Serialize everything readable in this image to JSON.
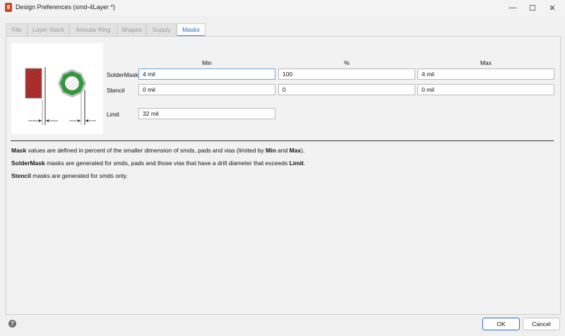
{
  "window": {
    "title": "Design Preferences (smd-4Layer *)",
    "controls": {
      "minimize": "—",
      "maximize": "☐",
      "close": "✕"
    }
  },
  "tabs": [
    {
      "label": "File"
    },
    {
      "label": "Layer Stack"
    },
    {
      "label": "Annular Ring"
    },
    {
      "label": "Shapes"
    },
    {
      "label": "Supply"
    },
    {
      "label": "Masks",
      "active": true
    }
  ],
  "masks": {
    "columns": {
      "min": "Min",
      "percent": "%",
      "max": "Max"
    },
    "soldermask": {
      "label": "SolderMask",
      "min": "4 mil",
      "percent": "100",
      "max": "4 mil"
    },
    "stencil": {
      "label": "Stencil",
      "min": "0 mil",
      "percent": "0",
      "max": "0 mil"
    },
    "limit": {
      "label": "Limit",
      "value": "32 mil"
    }
  },
  "description": {
    "line1": {
      "b1": "Mask",
      "t1": " values are defined in percent of the smaller dimension of smds, pads and vias (limited by ",
      "b2": "Min",
      "t2": " and ",
      "b3": "Max",
      "t3": ")."
    },
    "line2": {
      "b1": "SolderMask",
      "t1": " masks are generated for smds, pads and those vias that have a drill diameter that exceeds ",
      "b2": "Limit",
      "t2": "."
    },
    "line3": {
      "b1": "Stencil",
      "t1": " masks are generated for smds only."
    }
  },
  "footer": {
    "help": "?",
    "ok": "OK",
    "cancel": "Cancel"
  },
  "colors": {
    "accent": "#3b82cf",
    "smd_fill": "#b03030",
    "pad_fill": "#2e9a3a"
  }
}
